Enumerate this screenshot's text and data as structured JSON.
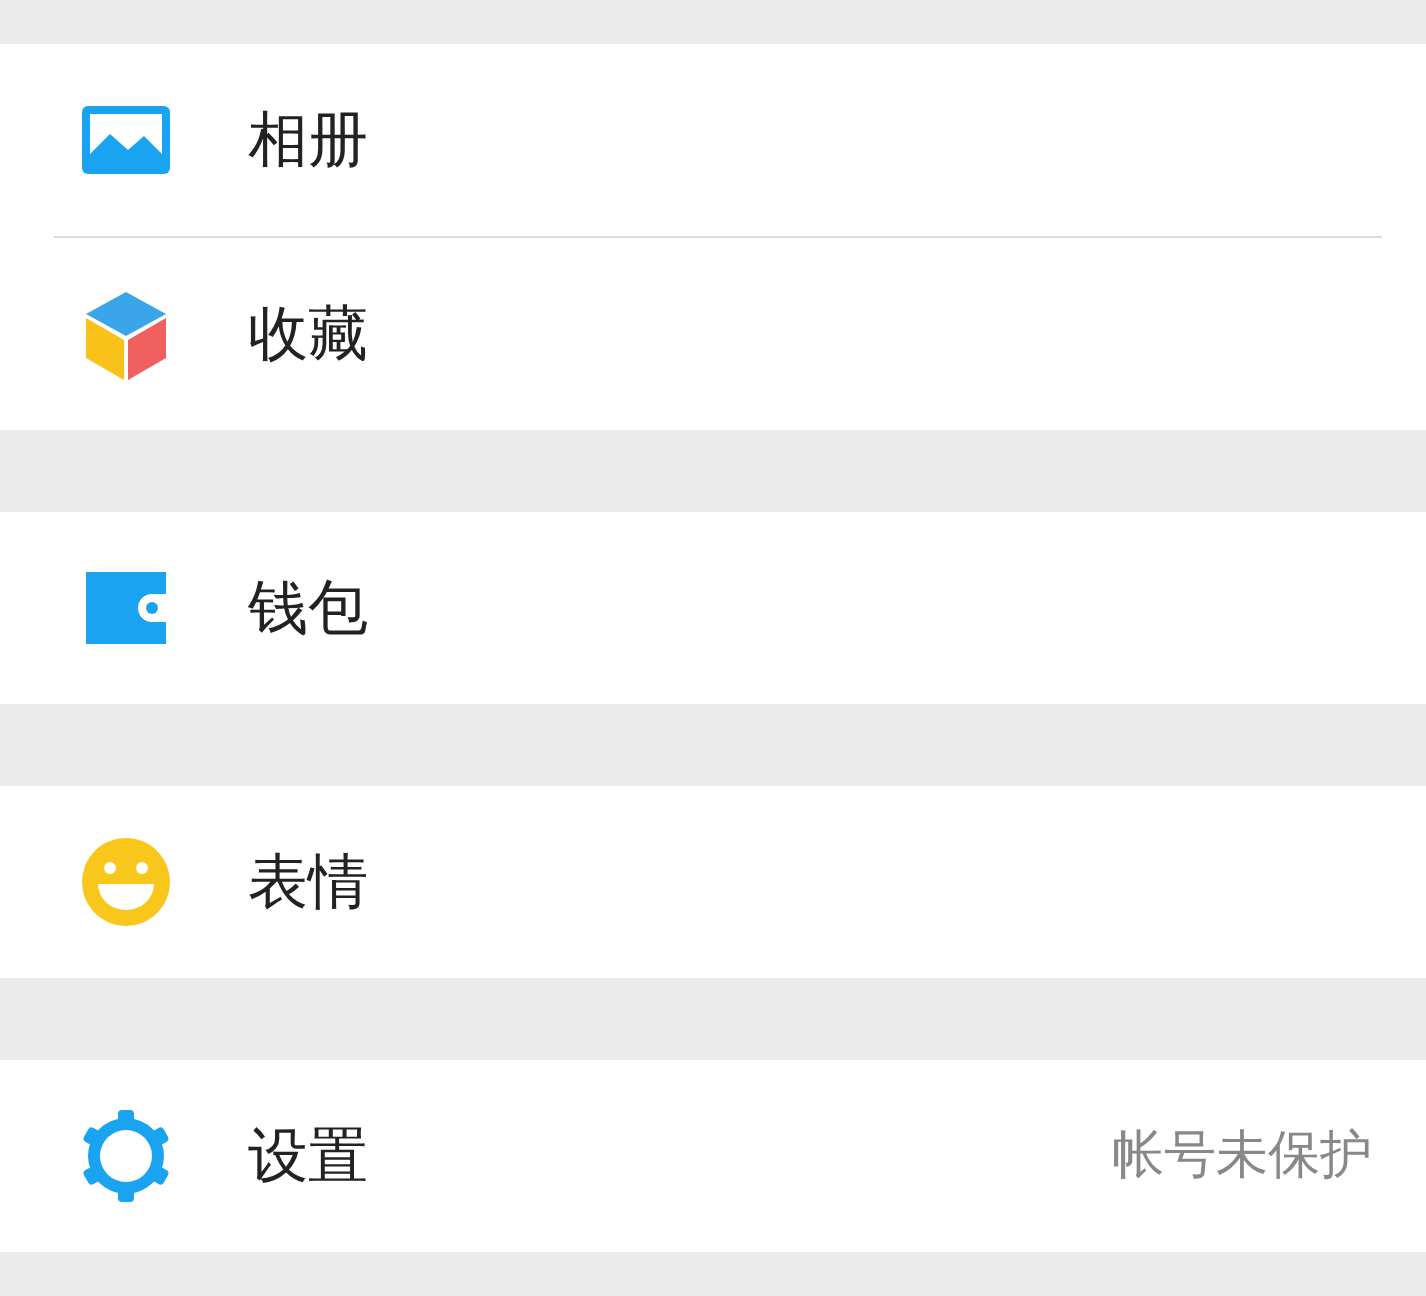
{
  "groups": [
    {
      "items": [
        {
          "label": "相册"
        },
        {
          "label": "收藏"
        }
      ]
    },
    {
      "items": [
        {
          "label": "钱包"
        }
      ]
    },
    {
      "items": [
        {
          "label": "表情"
        }
      ]
    },
    {
      "items": [
        {
          "label": "设置",
          "detail": "帐号未保护"
        }
      ]
    }
  ]
}
